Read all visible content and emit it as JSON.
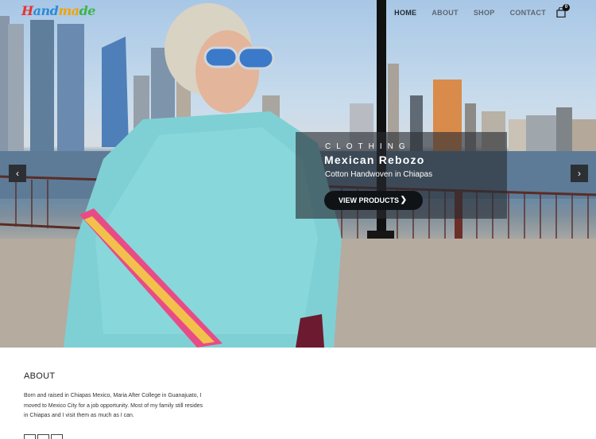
{
  "header": {
    "logo_parts": [
      "H",
      "and",
      "ma",
      "de"
    ],
    "logo_sub": "",
    "nav": [
      {
        "label": "HOME",
        "active": true
      },
      {
        "label": "ABOUT",
        "active": false
      },
      {
        "label": "SHOP",
        "active": false
      },
      {
        "label": "CONTACT",
        "active": false
      }
    ],
    "cart_count": "0"
  },
  "slide": {
    "category": "CLOTHING",
    "title": "Mexican Rebozo",
    "subtitle": "Cotton Handwoven in Chiapas",
    "button_label": "VIEW PRODUCTS",
    "prev_icon": "‹",
    "next_icon": "›"
  },
  "about": {
    "title": "ABOUT",
    "text": "Born and raised in Chiapas Mexico, Maria After College in Guanajuato, I moved to Mexico City for a job opportunity. Most of my family still resides in Chiapas and I visit them as much as I can."
  },
  "colors": {
    "accent": "#101316",
    "caption_bg": "rgba(40,44,50,0.62)",
    "shawl": "#7fd0d4"
  }
}
